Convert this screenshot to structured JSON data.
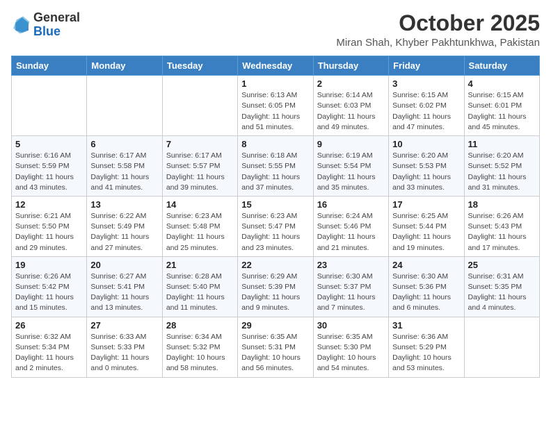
{
  "header": {
    "logo": {
      "line1": "General",
      "line2": "Blue"
    },
    "title": "October 2025",
    "subtitle": "Miran Shah, Khyber Pakhtunkhwa, Pakistan"
  },
  "weekdays": [
    "Sunday",
    "Monday",
    "Tuesday",
    "Wednesday",
    "Thursday",
    "Friday",
    "Saturday"
  ],
  "weeks": [
    [
      {
        "day": "",
        "info": ""
      },
      {
        "day": "",
        "info": ""
      },
      {
        "day": "",
        "info": ""
      },
      {
        "day": "1",
        "info": "Sunrise: 6:13 AM\nSunset: 6:05 PM\nDaylight: 11 hours\nand 51 minutes."
      },
      {
        "day": "2",
        "info": "Sunrise: 6:14 AM\nSunset: 6:03 PM\nDaylight: 11 hours\nand 49 minutes."
      },
      {
        "day": "3",
        "info": "Sunrise: 6:15 AM\nSunset: 6:02 PM\nDaylight: 11 hours\nand 47 minutes."
      },
      {
        "day": "4",
        "info": "Sunrise: 6:15 AM\nSunset: 6:01 PM\nDaylight: 11 hours\nand 45 minutes."
      }
    ],
    [
      {
        "day": "5",
        "info": "Sunrise: 6:16 AM\nSunset: 5:59 PM\nDaylight: 11 hours\nand 43 minutes."
      },
      {
        "day": "6",
        "info": "Sunrise: 6:17 AM\nSunset: 5:58 PM\nDaylight: 11 hours\nand 41 minutes."
      },
      {
        "day": "7",
        "info": "Sunrise: 6:17 AM\nSunset: 5:57 PM\nDaylight: 11 hours\nand 39 minutes."
      },
      {
        "day": "8",
        "info": "Sunrise: 6:18 AM\nSunset: 5:55 PM\nDaylight: 11 hours\nand 37 minutes."
      },
      {
        "day": "9",
        "info": "Sunrise: 6:19 AM\nSunset: 5:54 PM\nDaylight: 11 hours\nand 35 minutes."
      },
      {
        "day": "10",
        "info": "Sunrise: 6:20 AM\nSunset: 5:53 PM\nDaylight: 11 hours\nand 33 minutes."
      },
      {
        "day": "11",
        "info": "Sunrise: 6:20 AM\nSunset: 5:52 PM\nDaylight: 11 hours\nand 31 minutes."
      }
    ],
    [
      {
        "day": "12",
        "info": "Sunrise: 6:21 AM\nSunset: 5:50 PM\nDaylight: 11 hours\nand 29 minutes."
      },
      {
        "day": "13",
        "info": "Sunrise: 6:22 AM\nSunset: 5:49 PM\nDaylight: 11 hours\nand 27 minutes."
      },
      {
        "day": "14",
        "info": "Sunrise: 6:23 AM\nSunset: 5:48 PM\nDaylight: 11 hours\nand 25 minutes."
      },
      {
        "day": "15",
        "info": "Sunrise: 6:23 AM\nSunset: 5:47 PM\nDaylight: 11 hours\nand 23 minutes."
      },
      {
        "day": "16",
        "info": "Sunrise: 6:24 AM\nSunset: 5:46 PM\nDaylight: 11 hours\nand 21 minutes."
      },
      {
        "day": "17",
        "info": "Sunrise: 6:25 AM\nSunset: 5:44 PM\nDaylight: 11 hours\nand 19 minutes."
      },
      {
        "day": "18",
        "info": "Sunrise: 6:26 AM\nSunset: 5:43 PM\nDaylight: 11 hours\nand 17 minutes."
      }
    ],
    [
      {
        "day": "19",
        "info": "Sunrise: 6:26 AM\nSunset: 5:42 PM\nDaylight: 11 hours\nand 15 minutes."
      },
      {
        "day": "20",
        "info": "Sunrise: 6:27 AM\nSunset: 5:41 PM\nDaylight: 11 hours\nand 13 minutes."
      },
      {
        "day": "21",
        "info": "Sunrise: 6:28 AM\nSunset: 5:40 PM\nDaylight: 11 hours\nand 11 minutes."
      },
      {
        "day": "22",
        "info": "Sunrise: 6:29 AM\nSunset: 5:39 PM\nDaylight: 11 hours\nand 9 minutes."
      },
      {
        "day": "23",
        "info": "Sunrise: 6:30 AM\nSunset: 5:37 PM\nDaylight: 11 hours\nand 7 minutes."
      },
      {
        "day": "24",
        "info": "Sunrise: 6:30 AM\nSunset: 5:36 PM\nDaylight: 11 hours\nand 6 minutes."
      },
      {
        "day": "25",
        "info": "Sunrise: 6:31 AM\nSunset: 5:35 PM\nDaylight: 11 hours\nand 4 minutes."
      }
    ],
    [
      {
        "day": "26",
        "info": "Sunrise: 6:32 AM\nSunset: 5:34 PM\nDaylight: 11 hours\nand 2 minutes."
      },
      {
        "day": "27",
        "info": "Sunrise: 6:33 AM\nSunset: 5:33 PM\nDaylight: 11 hours\nand 0 minutes."
      },
      {
        "day": "28",
        "info": "Sunrise: 6:34 AM\nSunset: 5:32 PM\nDaylight: 10 hours\nand 58 minutes."
      },
      {
        "day": "29",
        "info": "Sunrise: 6:35 AM\nSunset: 5:31 PM\nDaylight: 10 hours\nand 56 minutes."
      },
      {
        "day": "30",
        "info": "Sunrise: 6:35 AM\nSunset: 5:30 PM\nDaylight: 10 hours\nand 54 minutes."
      },
      {
        "day": "31",
        "info": "Sunrise: 6:36 AM\nSunset: 5:29 PM\nDaylight: 10 hours\nand 53 minutes."
      },
      {
        "day": "",
        "info": ""
      }
    ]
  ]
}
